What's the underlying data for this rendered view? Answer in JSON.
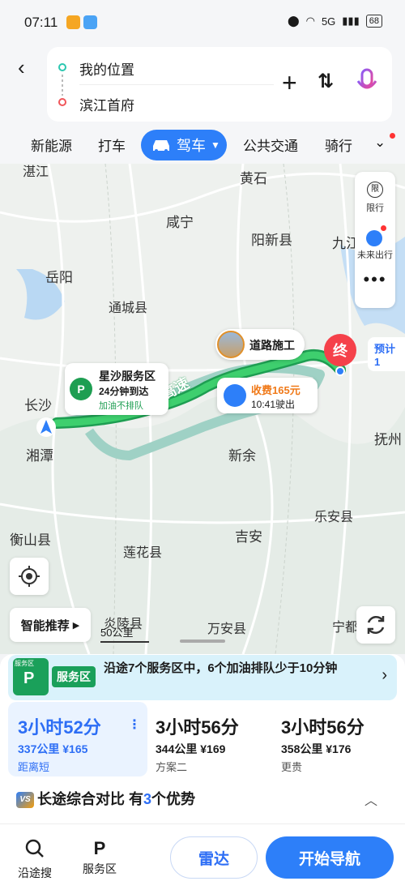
{
  "status_bar": {
    "time": "07:11",
    "signal_label": "5G",
    "battery": "68"
  },
  "search": {
    "from": "我的位置",
    "to": "滨江首府"
  },
  "tabs": [
    {
      "label": "新能源"
    },
    {
      "label": "打车"
    },
    {
      "label": "驾车"
    },
    {
      "label": "公共交通"
    },
    {
      "label": "骑行"
    }
  ],
  "map": {
    "places": [
      "湛江",
      "黄石",
      "咸宁",
      "阳新县",
      "九江",
      "岳阳",
      "通城县",
      "长沙",
      "湘潭",
      "新余",
      "抚州",
      "衡山县",
      "吉安",
      "乐安县",
      "莲花县",
      "炎陵县",
      "万安县",
      "宁都"
    ],
    "road_label": "高速",
    "controls": {
      "limit_label": "限行",
      "future_label": "未来出行"
    },
    "callouts": {
      "service": {
        "title": "星沙服务区",
        "eta": "24分钟到达",
        "note": "加油不排队"
      },
      "construction": {
        "label": "道路施工"
      },
      "toll": {
        "fee": "收费165元",
        "exit": "10:41驶出"
      },
      "end_marker": "终",
      "eta_label": "预计1"
    },
    "smart_label": "智能推荐",
    "scale_label": "50公里"
  },
  "service_banner": {
    "tag": "服务区",
    "icon_tag": "服务区",
    "text": "沿途7个服务区中，6个加油排队少于10分钟"
  },
  "plans": [
    {
      "time": "3小时52分",
      "distance": "337公里",
      "fee": "¥165",
      "note": "距离短"
    },
    {
      "time": "3小时56分",
      "distance": "344公里",
      "fee": "¥169",
      "note": "方案二"
    },
    {
      "time": "3小时56分",
      "distance": "358公里",
      "fee": "¥176",
      "note": "更贵"
    }
  ],
  "compare": {
    "icon": "VS",
    "prefix": "长途综合对比 有",
    "count": "3",
    "suffix": "个优势"
  },
  "bottom": {
    "along_search": "沿途搜",
    "service_area": "服务区",
    "radar": "雷达",
    "start": "开始导航"
  }
}
